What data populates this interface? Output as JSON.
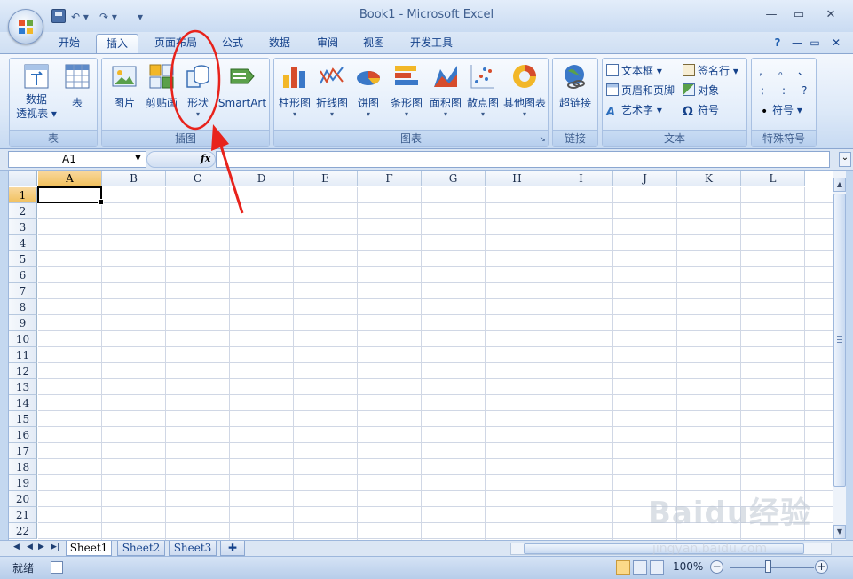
{
  "window": {
    "title": "Book1 - Microsoft Excel",
    "controls": [
      "—",
      "▭",
      "✕"
    ]
  },
  "quick_access": {
    "undo": "↶ ▾",
    "redo": "↷ ▾",
    "more": "▾"
  },
  "tabs": [
    {
      "label": "开始",
      "active": false
    },
    {
      "label": "插入",
      "active": true
    },
    {
      "label": "页面布局",
      "active": false
    },
    {
      "label": "公式",
      "active": false
    },
    {
      "label": "数据",
      "active": false
    },
    {
      "label": "审阅",
      "active": false
    },
    {
      "label": "视图",
      "active": false
    },
    {
      "label": "开发工具",
      "active": false
    }
  ],
  "ribbon_controls": {
    "help": "?",
    "minimize": "—",
    "restore": "▭",
    "close": "✕"
  },
  "ribbon": {
    "tables": {
      "label": "表",
      "pivot_line1": "数据",
      "pivot_line2": "透视表 ▾",
      "table": "表"
    },
    "illustrations": {
      "label": "插图",
      "picture": "图片",
      "clipart": "剪贴画",
      "shapes": "形状",
      "shapes_arrow": "▾",
      "smartart": "SmartArt"
    },
    "charts": {
      "label": "图表",
      "column": "柱形图",
      "line": "折线图",
      "pie": "饼图",
      "bar": "条形图",
      "area": "面积图",
      "scatter": "散点图",
      "other": "其他图表",
      "arrow": "▾",
      "launcher": "↘"
    },
    "links": {
      "label": "链接",
      "hyperlink": "超链接"
    },
    "text": {
      "label": "文本",
      "textbox": "文本框 ▾",
      "header_footer": "页眉和页脚",
      "wordart": "艺术字 ▾",
      "signature": "签名行 ▾",
      "object": "对象",
      "symbol": "符号"
    },
    "special": {
      "label": "特殊符号",
      "row1": [
        ",",
        "。",
        "、"
      ],
      "row2": [
        ";",
        ":",
        "?"
      ],
      "symbol": "符号 ▾"
    }
  },
  "formula_bar": {
    "name_box": "A1",
    "fx": "fx",
    "value": ""
  },
  "grid": {
    "columns": [
      "A",
      "B",
      "C",
      "D",
      "E",
      "F",
      "G",
      "H",
      "I",
      "J",
      "K",
      "L"
    ],
    "rows": [
      "1",
      "2",
      "3",
      "4",
      "5",
      "6",
      "7",
      "8",
      "9",
      "10",
      "11",
      "12",
      "13",
      "14",
      "15",
      "16",
      "17",
      "18",
      "19",
      "20",
      "21",
      "22"
    ],
    "selected_cell": "A1"
  },
  "sheets": [
    {
      "label": "Sheet1",
      "active": true
    },
    {
      "label": "Sheet2",
      "active": false
    },
    {
      "label": "Sheet3",
      "active": false
    }
  ],
  "sheet_nav": [
    "|◀",
    "◀",
    "▶",
    "▶|"
  ],
  "status": {
    "ready": "就绪",
    "zoom": "100%",
    "zoom_out": "−",
    "zoom_in": "+"
  },
  "colors": {
    "annotation": "#e8231c",
    "accent": "#15428b",
    "selection_header": "#f1c15f"
  },
  "watermark": {
    "brand": "Baidu经验",
    "url": "jingyan.baidu.com"
  }
}
